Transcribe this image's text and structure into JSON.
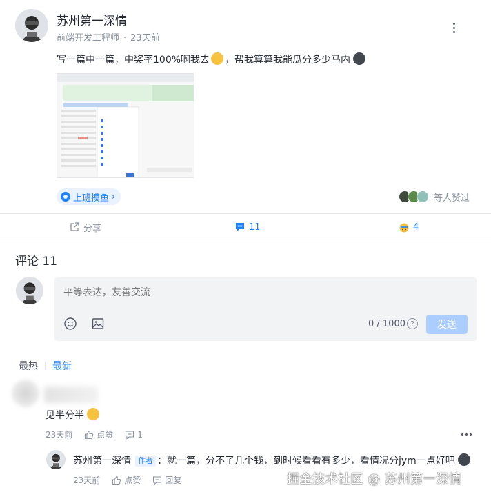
{
  "post": {
    "author_name": "苏州第一深情",
    "author_title": "前端开发工程师",
    "separator": "·",
    "time": "23天前",
    "text_part1": "写一篇中一篇，中奖率100%啊我去",
    "text_part2": "，帮我算算我能瓜分多少马内",
    "topic": "上班摸鱼",
    "topic_chevron": "›",
    "likers_text": "等人赞过"
  },
  "actions": {
    "share": "分享",
    "comments": "11",
    "likes": "4"
  },
  "comments": {
    "title": "评论 11",
    "placeholder": "平等表达，友善交流",
    "counter": "0 / 1000",
    "help": "?",
    "send": "发送",
    "sort_hot": "最热",
    "sort_new": "最新"
  },
  "comment1": {
    "text": "见半分半",
    "time": "23天前",
    "like": "点赞",
    "reply_count": "1"
  },
  "reply1": {
    "name": "苏州第一深情",
    "badge": "作者",
    "text": "：就一篇，分不了几个钱，到时候看看有多少，看情况分jym一点好吧",
    "time": "23天前",
    "like": "点赞",
    "reply": "回复"
  },
  "watermark": "掘金技术社区 @ 苏州第一深情",
  "colors": {
    "accent": "#1e80ff",
    "muted": "#8a919f",
    "send_disabled": "#abcdff"
  }
}
